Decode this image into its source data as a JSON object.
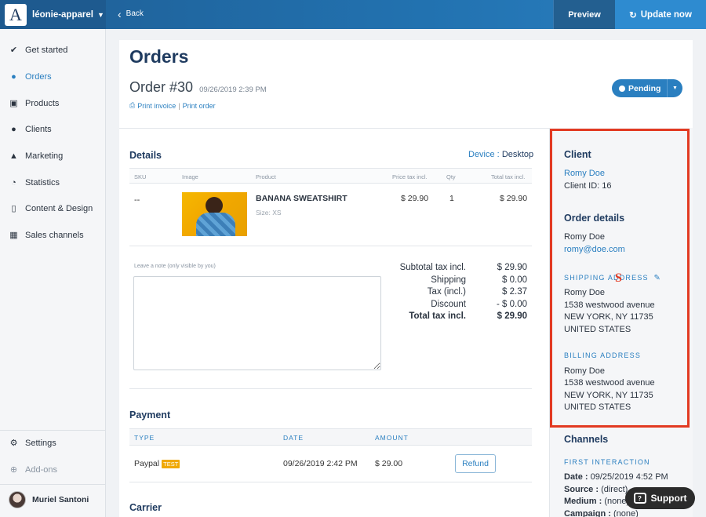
{
  "topbar": {
    "brand_letter": "A",
    "store_name": "léonie-apparel",
    "back_label": "Back",
    "preview_label": "Preview",
    "update_label": "Update now"
  },
  "sidebar": {
    "items": [
      {
        "label": "Get started",
        "icon": "check-circle-icon"
      },
      {
        "label": "Orders",
        "icon": "dollar-circle-icon"
      },
      {
        "label": "Products",
        "icon": "cart-icon"
      },
      {
        "label": "Clients",
        "icon": "users-icon"
      },
      {
        "label": "Marketing",
        "icon": "bell-icon"
      },
      {
        "label": "Statistics",
        "icon": "pie-chart-icon"
      },
      {
        "label": "Content & Design",
        "icon": "mobile-icon"
      },
      {
        "label": "Sales channels",
        "icon": "store-icon"
      }
    ],
    "settings_label": "Settings",
    "addons_label": "Add-ons",
    "user_name": "Muriel Santoni"
  },
  "order": {
    "page_title": "Orders",
    "number": "Order #30",
    "date": "09/26/2019 2:39 PM",
    "print_invoice": "Print invoice",
    "print_order": "Print order",
    "status": "Pending"
  },
  "details": {
    "title": "Details",
    "device_label": "Device :",
    "device_value": "Desktop",
    "columns": {
      "sku": "SKU",
      "image": "Image",
      "product": "Product",
      "price": "Price tax incl.",
      "qty": "Qty",
      "total": "Total tax incl."
    },
    "row": {
      "sku": "--",
      "product_name": "BANANA SWEATSHIRT",
      "size": "Size: XS",
      "price": "$ 29.90",
      "qty": "1",
      "total": "$ 29.90"
    },
    "note_label": "Leave a note (only visible by you)"
  },
  "summary": {
    "subtotal_label": "Subtotal tax incl.",
    "subtotal_value": "$ 29.90",
    "shipping_label": "Shipping",
    "shipping_value": "$ 0.00",
    "tax_label": "Tax (incl.)",
    "tax_value": "$ 2.37",
    "discount_label": "Discount",
    "discount_value": "- $ 0.00",
    "total_label": "Total tax incl.",
    "total_value": "$ 29.90"
  },
  "payment": {
    "title": "Payment",
    "col_type": "TYPE",
    "col_date": "DATE",
    "col_amount": "AMOUNT",
    "method": "Paypal",
    "badge": "TEST",
    "date": "09/26/2019 2:42 PM",
    "amount": "$ 29.00",
    "refund_label": "Refund"
  },
  "carrier": {
    "title": "Carrier"
  },
  "client_panel": {
    "client_title": "Client",
    "client_name": "Romy Doe",
    "client_id": "Client ID: 16",
    "order_details_title": "Order details",
    "od_name": "Romy Doe",
    "od_email": "romy@doe.com",
    "shipping_title": "SHIPPING ADDRESS",
    "shipping_lines": [
      "Romy Doe",
      "1538 westwood avenue",
      "NEW YORK, NY 11735",
      "UNITED STATES"
    ],
    "billing_title": "BILLING ADDRESS",
    "billing_lines": [
      "Romy Doe",
      "1538 westwood avenue",
      "NEW YORK, NY 11735",
      "UNITED STATES"
    ],
    "channels_title": "Channels",
    "first_interaction": "FIRST INTERACTION",
    "date_label": "Date :",
    "date_value": "09/25/2019 4:52 PM",
    "source_label": "Source :",
    "source_value": "(direct)",
    "medium_label": "Medium :",
    "medium_value": "(none)",
    "campaign_label": "Campaign :",
    "campaign_value": "(none)"
  },
  "support_label": "Support",
  "accent_color": "#2a7fc0",
  "highlight_color": "#e23a22"
}
